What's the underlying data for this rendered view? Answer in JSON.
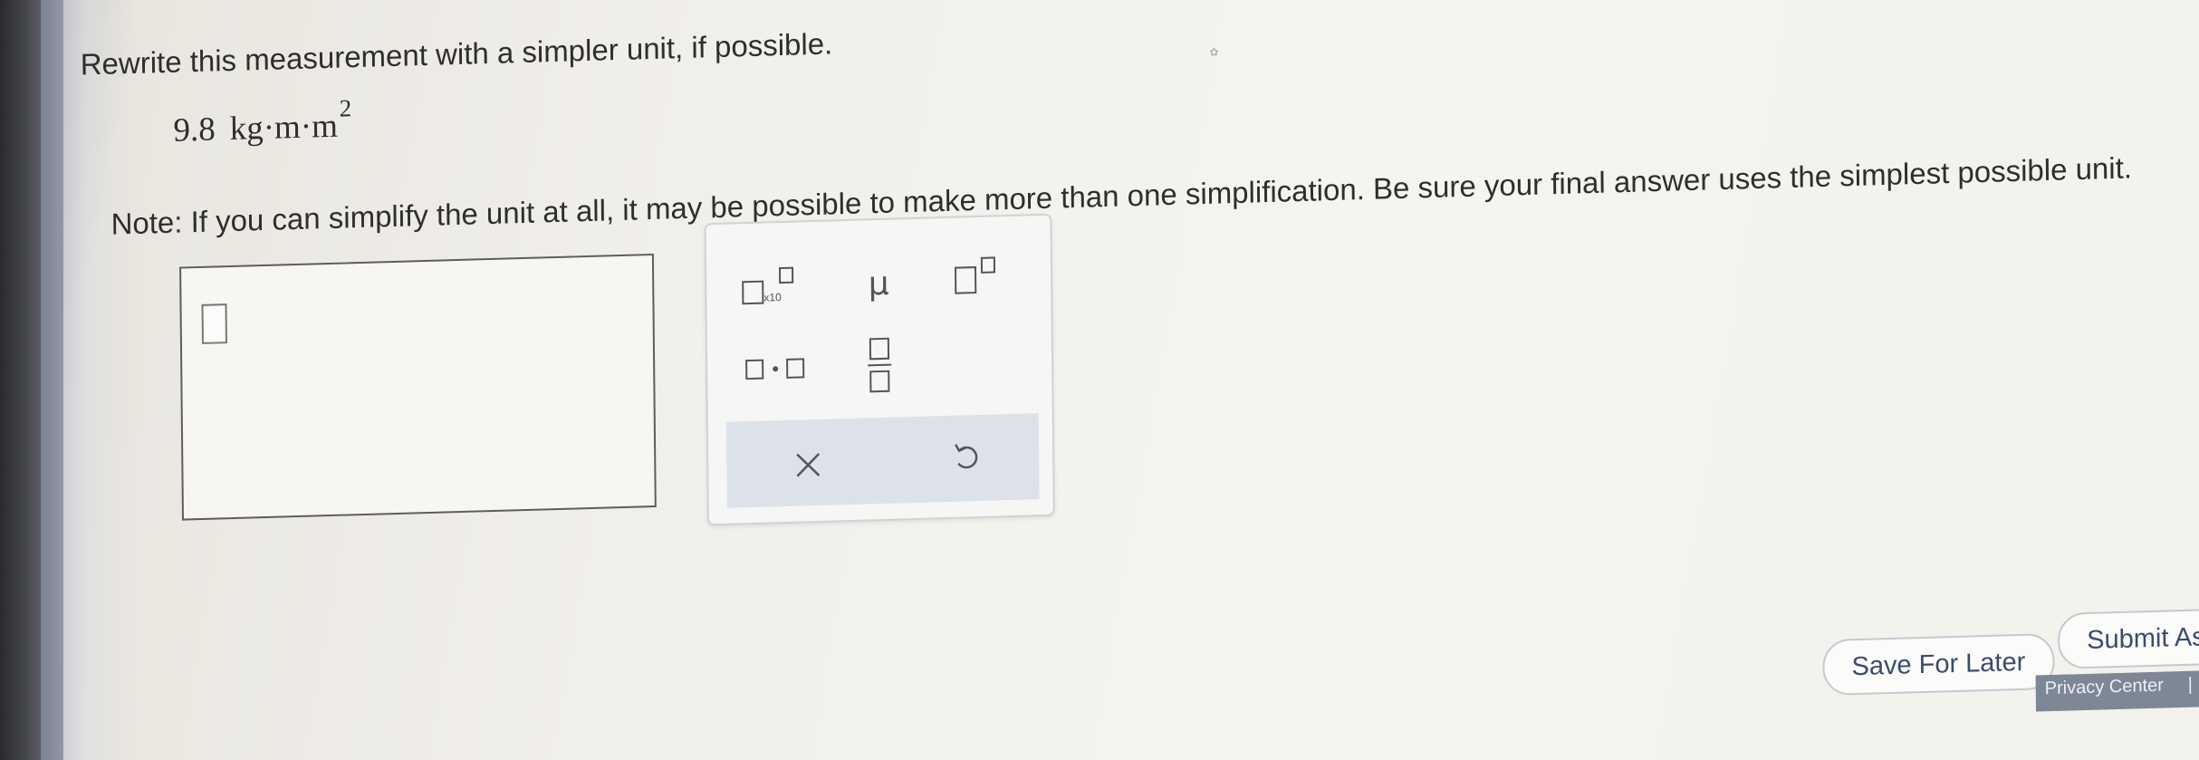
{
  "question": {
    "prompt": "Rewrite this measurement with a simpler unit, if possible.",
    "measurement_value": "9.8",
    "measurement_unit": "kg·m·m",
    "measurement_exponent": "2",
    "note": "Note: If you can simplify the unit at all, it may be possible to make more than one simplification. Be sure your final answer uses the simplest possible unit."
  },
  "answer": {
    "value": ""
  },
  "palette": {
    "tools": [
      {
        "name": "scientific-notation",
        "icon": "x10-template-icon",
        "label": "x10"
      },
      {
        "name": "micro",
        "icon": "mu-symbol-icon",
        "label": "μ"
      },
      {
        "name": "superscript",
        "icon": "superscript-template-icon"
      },
      {
        "name": "multiply-dot",
        "icon": "dot-product-template-icon"
      },
      {
        "name": "fraction",
        "icon": "fraction-template-icon"
      }
    ],
    "clear_icon": "close-icon",
    "undo_icon": "undo-icon"
  },
  "actions": {
    "save_label": "Save For Later",
    "submit_label": "Submit As"
  },
  "footer": {
    "privacy_label": "Privacy Center",
    "separator": "|"
  },
  "colors": {
    "button_text": "#3a4b6b",
    "palette_footer": "#dde2ea",
    "footer_bar": "#7d8796"
  }
}
